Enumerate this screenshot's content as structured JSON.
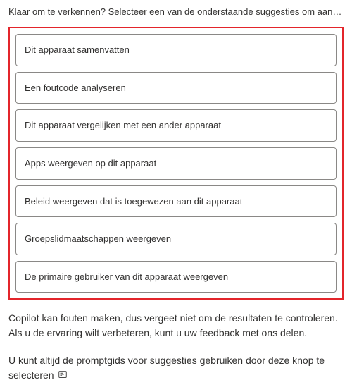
{
  "intro": "Klaar om te verkennen? Selecteer een van de onderstaande suggesties om aan de slag te gaan...",
  "suggestions": [
    {
      "label": "Dit apparaat samenvatten"
    },
    {
      "label": "Een foutcode analyseren"
    },
    {
      "label": "Dit apparaat vergelijken met een ander apparaat"
    },
    {
      "label": "Apps weergeven op dit apparaat"
    },
    {
      "label": "Beleid weergeven dat is toegewezen aan dit apparaat"
    },
    {
      "label": "Groepslidmaatschappen weergeven"
    },
    {
      "label": "De primaire gebruiker van dit apparaat weergeven"
    }
  ],
  "disclaimer": "Copilot kan fouten maken, dus vergeet niet om de resultaten te controleren. Als u de ervaring wilt verbeteren, kunt u uw feedback met ons delen.",
  "prompt_guide": "U kunt altijd de promptgids voor suggesties gebruiken door deze knop te selecteren"
}
